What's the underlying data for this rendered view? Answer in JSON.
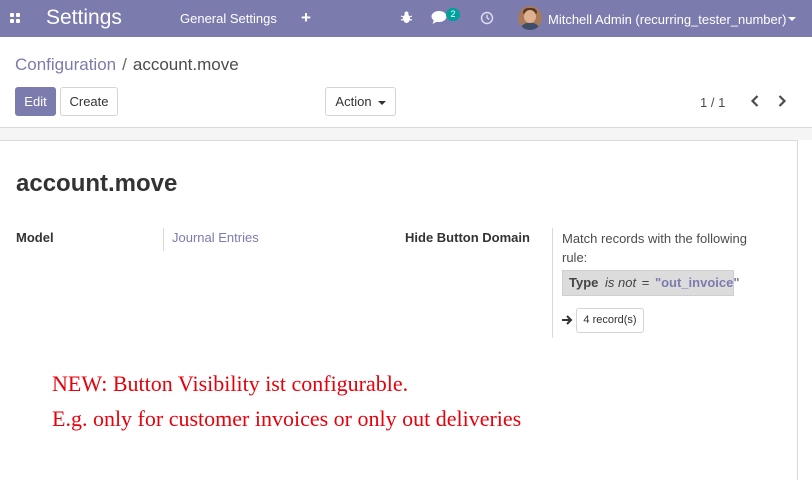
{
  "navbar": {
    "app_title": "Settings",
    "menu_item": "General Settings",
    "add_symbol": "+",
    "messages_badge": "2",
    "user_name": "Mitchell Admin (recurring_tester_number)",
    "background_color": "#7c7bad",
    "icons": [
      "apps-icon",
      "bug-icon",
      "chat-icon",
      "clock-icon",
      "avatar",
      "caret-down-icon"
    ]
  },
  "breadcrumb": {
    "parent": "Configuration",
    "separator": "/",
    "current": "account.move"
  },
  "toolbar": {
    "edit_label": "Edit",
    "create_label": "Create",
    "action_label": "Action",
    "pager_value": "1 / 1",
    "primary_color": "#7c7bad"
  },
  "form": {
    "title": "account.move",
    "model_label": "Model",
    "model_value": "Journal Entries",
    "domain_label": "Hide Button Domain",
    "domain_description": "Match records with the following rule:",
    "rule": {
      "field": "Type",
      "operator": "is not",
      "equals": "=",
      "value": "\"out_invoice\""
    },
    "records_label": "4 record(s)"
  },
  "annotation": {
    "line1": "NEW: Button Visibility ist configurable.",
    "line2": "E.g. only for customer invoices or only out deliveries",
    "color": "#e8000b"
  }
}
